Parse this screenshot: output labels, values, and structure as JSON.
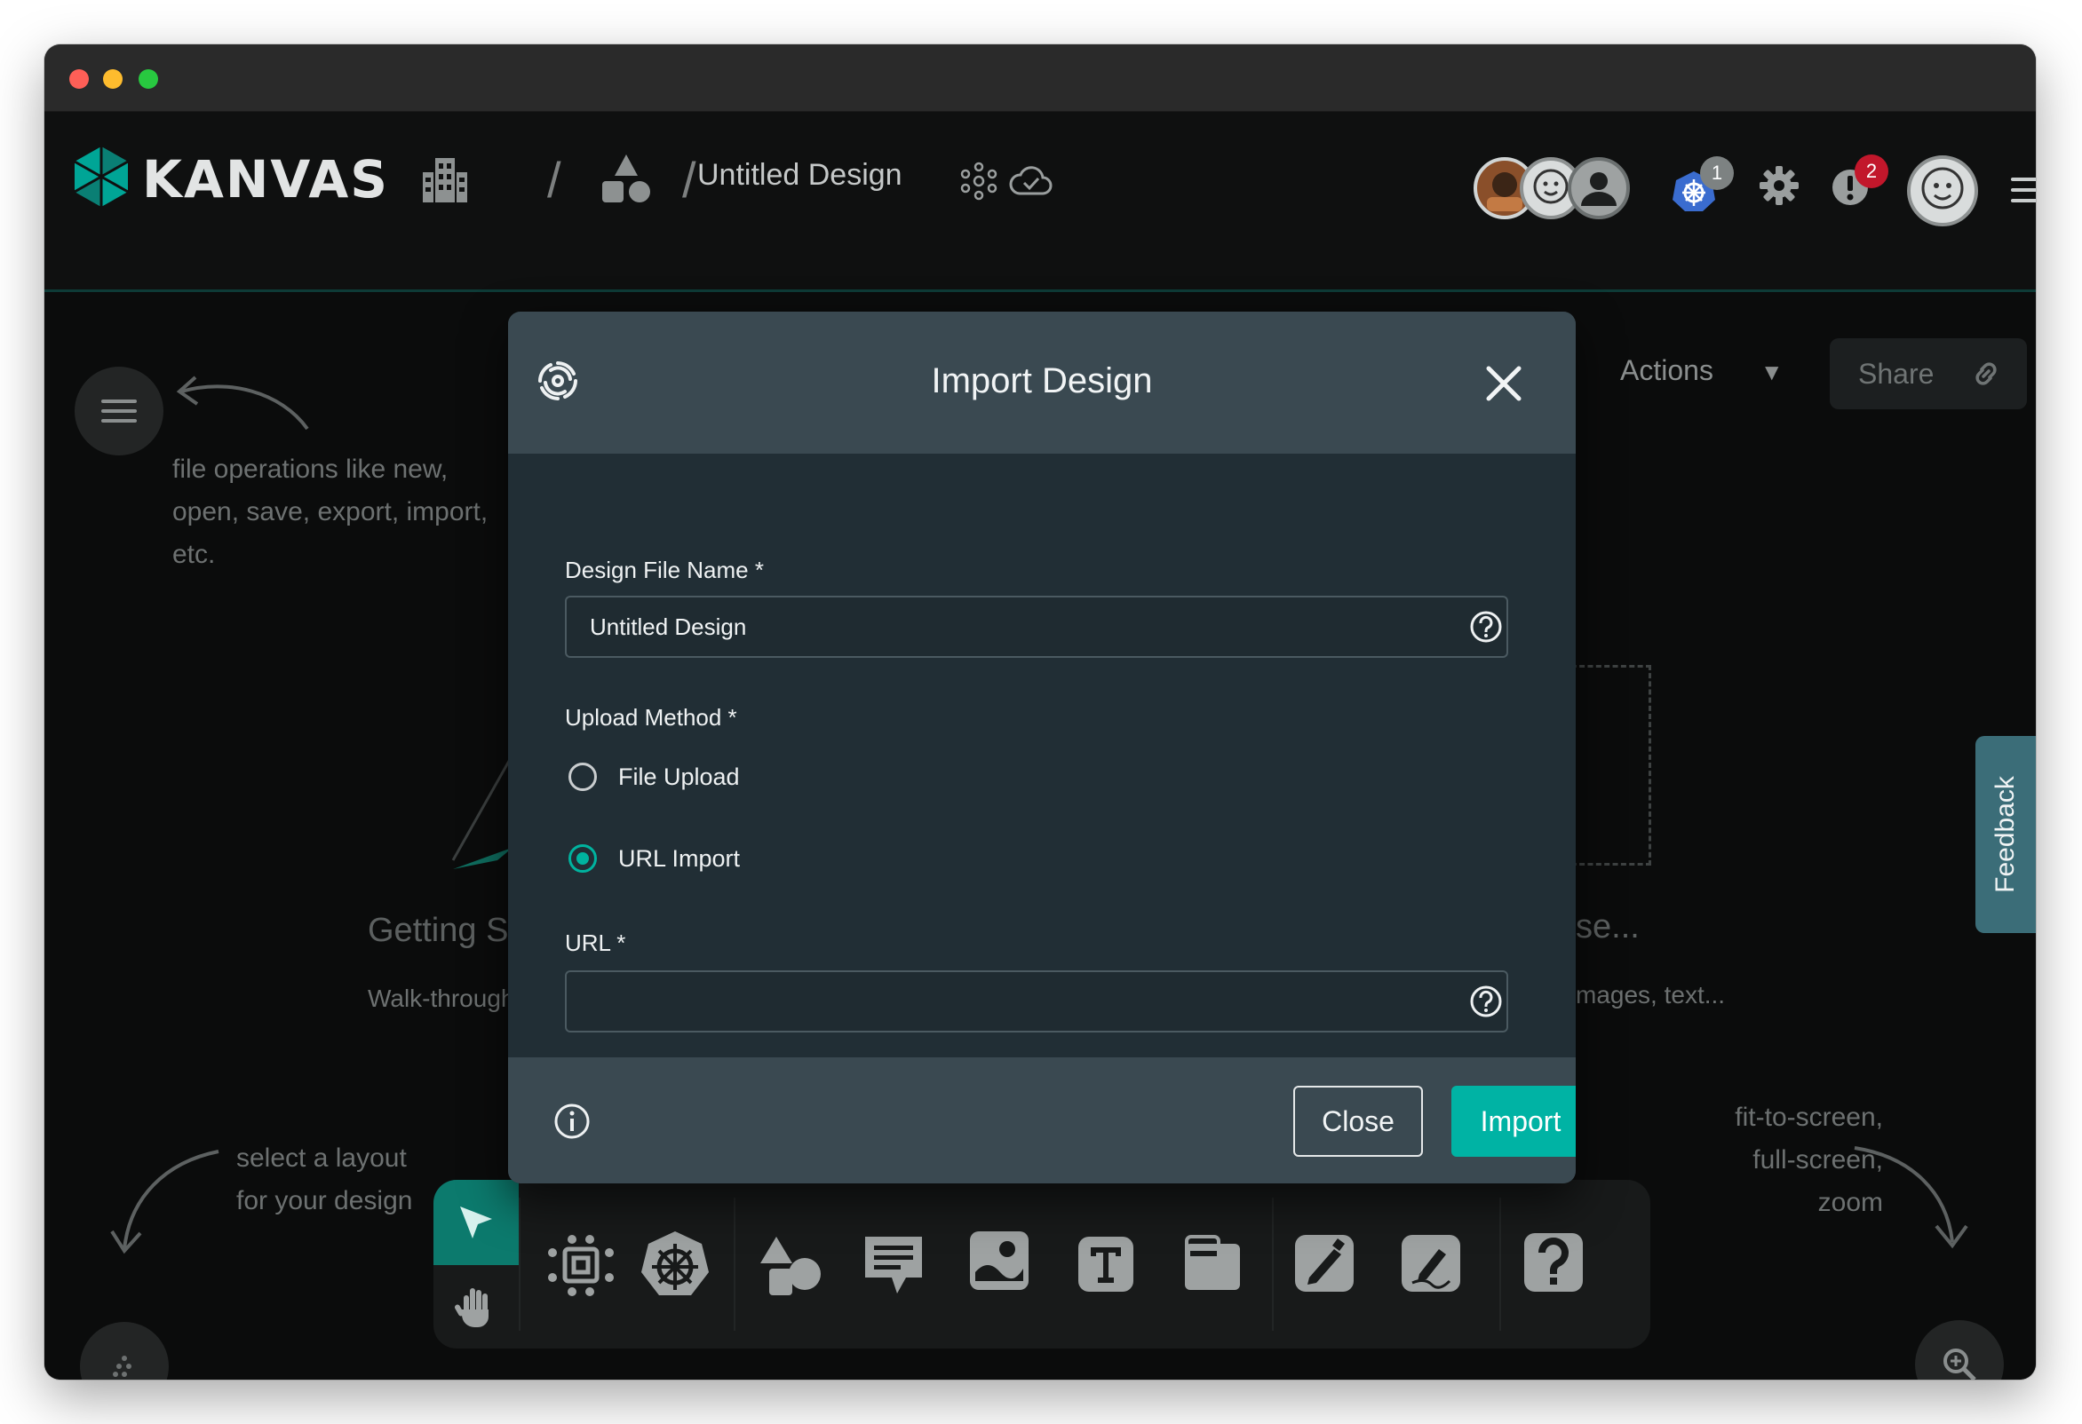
{
  "header": {
    "logo_text": "KANVAS",
    "design_title": "Untitled Design",
    "kubernetes_badge": "1",
    "notification_badge": "2"
  },
  "canvas": {
    "hint_file_ops": [
      "file operations like new,",
      "open, save, export, import,",
      "etc."
    ],
    "hint_layout": [
      "select a layout",
      "for your design"
    ],
    "hint_zoom": [
      "fit-to-screen,",
      "full-screen,",
      "zoom"
    ],
    "getting_started_title": "Getting S",
    "getting_started_sub": "Walk-through",
    "right_card_title": "se...",
    "right_card_sub": "mages, text...",
    "actions_label": "Actions",
    "share_label": "Share",
    "feedback_label": "Feedback"
  },
  "modal": {
    "title": "Import Design",
    "design_file_name_label": "Design File Name *",
    "design_file_name_value": "Untitled Design",
    "upload_method_label": "Upload Method *",
    "options": [
      {
        "label": "File Upload",
        "checked": false
      },
      {
        "label": "URL Import",
        "checked": true
      }
    ],
    "url_label": "URL *",
    "url_value": "",
    "close_label": "Close",
    "import_label": "Import"
  },
  "colors": {
    "accent": "#00b3a4",
    "modal_bg": "#212e35",
    "modal_header": "#3a4951",
    "badge_red": "#c2172b"
  }
}
